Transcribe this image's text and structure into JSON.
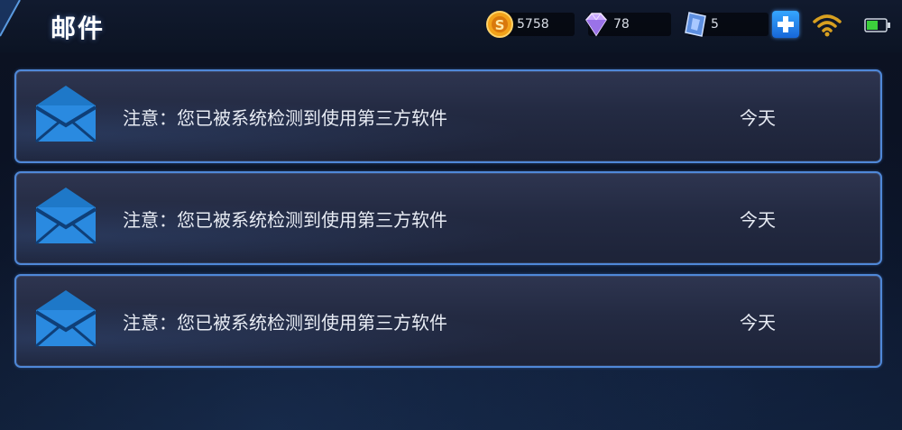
{
  "header": {
    "title": "邮件"
  },
  "resources": {
    "gold": {
      "value": "5758",
      "icon": "gold-coin-icon",
      "color": "#f2a21a"
    },
    "diamond": {
      "value": "78",
      "icon": "diamond-icon",
      "color": "#c9a8ff"
    },
    "voucher": {
      "value": "5",
      "icon": "voucher-crystal-icon",
      "color": "#7fb0ff"
    }
  },
  "status": {
    "wifi_icon": "wifi-icon",
    "battery_icon": "battery-icon"
  },
  "mail": {
    "items": [
      {
        "subject": "注意：您已被系统检测到使用第三方软件",
        "date": "今天",
        "icon": "envelope-icon"
      },
      {
        "subject": "注意：您已被系统检测到使用第三方软件",
        "date": "今天",
        "icon": "envelope-icon"
      },
      {
        "subject": "注意：您已被系统检测到使用第三方软件",
        "date": "今天",
        "icon": "envelope-icon"
      }
    ]
  },
  "colors": {
    "accent_border": "#4f88d8",
    "plus_button": "#2a8cf0",
    "battery_green": "#3ccf3c"
  }
}
